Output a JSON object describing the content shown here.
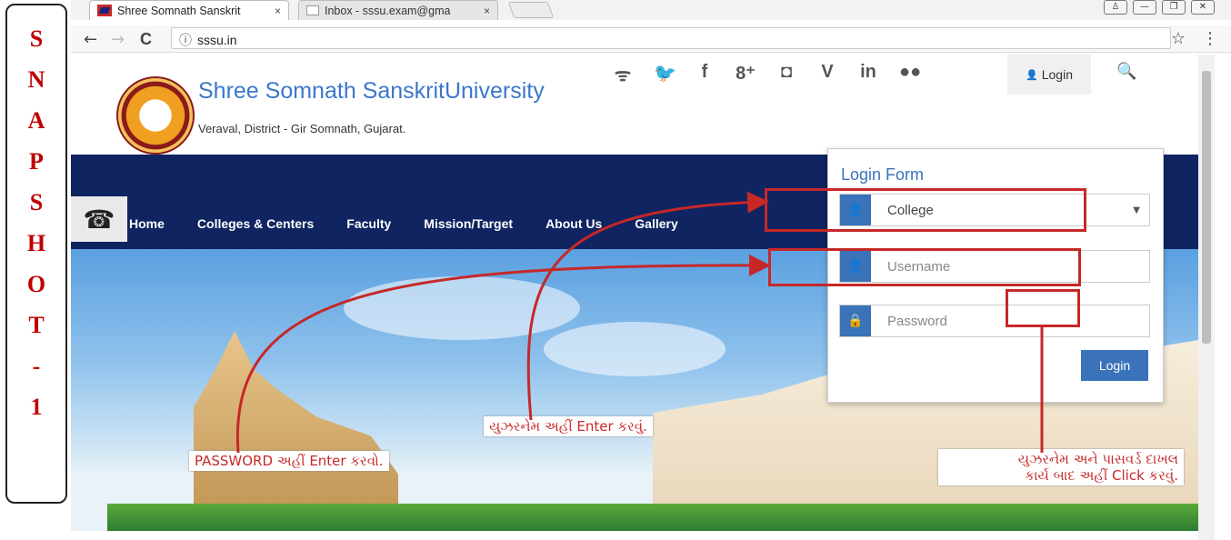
{
  "snapshot_label": [
    "S",
    "N",
    "A",
    "P",
    "S",
    "H",
    "O",
    "T",
    "-",
    "1"
  ],
  "browser": {
    "tabs": [
      {
        "title": "Shree Somnath Sanskrit",
        "close": "×"
      },
      {
        "title": "Inbox - sssu.exam@gma",
        "close": "×"
      }
    ],
    "url": "sssu.in",
    "back": "←",
    "forward": "→",
    "reload": "C",
    "info": "ⓘ",
    "star": "☆",
    "menu": "⋮",
    "window_buttons": [
      "♙",
      "—",
      "❐",
      "✕"
    ]
  },
  "header": {
    "university_name": "Shree Somnath SanskritUniversity",
    "location": "Veraval, District - Gir Somnath, Gujarat.",
    "social_icons": [
      "rss-icon",
      "twitter-icon",
      "facebook-icon",
      "google-plus-icon",
      "instagram-icon",
      "vine-icon",
      "linkedin-icon",
      "flickr-icon"
    ],
    "social_glyphs": [
      "ᯤ",
      "🐦",
      "f",
      "8⁺",
      "◘",
      "V",
      "in",
      "●●"
    ],
    "login_label": "Login",
    "search_glyph": "🔍"
  },
  "nav": {
    "phone_glyph": "☎",
    "items": [
      "Home",
      "Colleges & Centers",
      "Faculty",
      "Mission/Target",
      "About Us",
      "Gallery"
    ],
    "hamburger": "≡"
  },
  "login_form": {
    "title": "Login Form",
    "type_select": "College",
    "username_placeholder": "Username",
    "password_placeholder": "Password",
    "submit_label": "Login",
    "user_glyph": "👤",
    "lock_glyph": "🔒",
    "caret": "▼"
  },
  "annotations": {
    "username": "યુઝરનેમ અહીં Enter કરવું.",
    "password": "PASSWORD અહીં Enter કરવો.",
    "click_line1": "યુઝરનેમ અને પાસવર્ડ દાખલ",
    "click_line2": "કાર્ય બાદ અહીં Click કરવું."
  },
  "colors": {
    "annotation_red": "#c62828",
    "nav_blue": "#0f2461",
    "accent_blue": "#3a73b9"
  }
}
